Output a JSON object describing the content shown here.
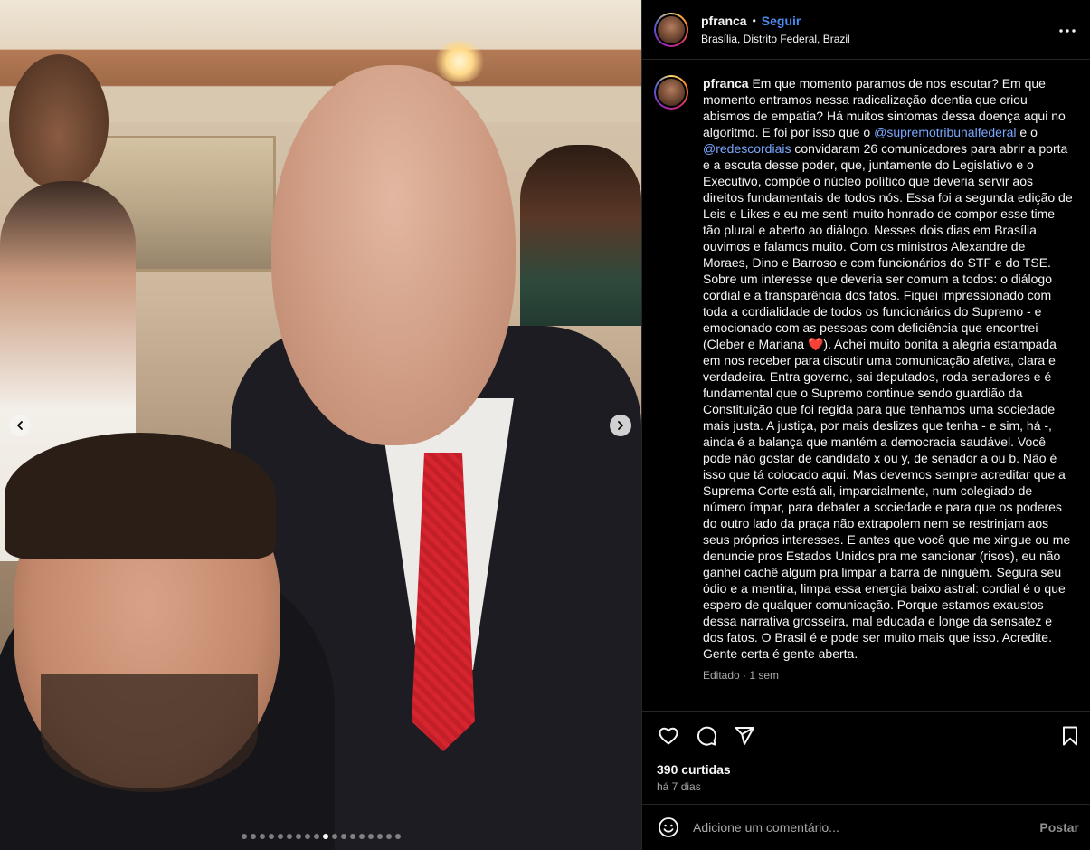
{
  "post": {
    "username": "pfranca",
    "separator": "•",
    "follow_label": "Seguir",
    "location": "Brasília, Distrito Federal, Brazil"
  },
  "carousel": {
    "total_slides": 18,
    "active_slide": 10
  },
  "caption": {
    "username": "pfranca",
    "part1": " Em que momento paramos de nos escutar? Em que momento entramos nessa radicalização doentia que criou abismos de empatia? Há muitos sintomas dessa doença aqui no algoritmo. E foi por isso que o ",
    "mention1": "@supremotribunalfederal",
    "part2": " e o ",
    "mention2": "@redescordiais",
    "part3": " convidaram 26 comunicadores para abrir a porta e a escuta desse poder, que, juntamente do Legislativo e o Executivo, compõe o núcleo político que deveria servir aos direitos fundamentais de todos nós. Essa foi a segunda edição de Leis e Likes e eu me senti muito honrado de compor esse time tão plural e aberto ao diálogo. Nesses dois dias em Brasília ouvimos e falamos muito. Com os ministros Alexandre de Moraes, Dino e Barroso e com funcionários do STF e do TSE. Sobre um interesse que deveria ser comum a todos: o diálogo cordial e a transparência dos fatos. Fiquei impressionado com toda a cordialidade de todos os funcionários do Supremo - e emocionado com as pessoas com deficiência que encontrei (Cleber e Mariana ❤️). Achei muito bonita a alegria estampada em nos receber para discutir uma comunicação afetiva, clara e verdadeira. Entra governo, sai deputados, roda senadores e é fundamental que o Supremo continue sendo guardião da Constituição que foi regida para que tenhamos uma sociedade mais justa. A justiça, por mais deslizes que tenha - e sim, há -, ainda é a balança que mantém a democracia saudável. Você pode não gostar de candidato x ou y, de senador a ou b. Não é isso que tá colocado aqui. Mas devemos sempre acreditar que a Suprema Corte está ali, imparcialmente, num colegiado de número ímpar, para debater a sociedade e para que os poderes do outro lado da praça não extrapolem nem se restrinjam aos seus próprios interesses. E antes que você que me xingue ou me denuncie pros Estados Unidos pra me sancionar (risos), eu não ganhei cachê algum pra limpar a barra de ninguém. Segura seu ódio e a mentira, limpa essa energia baixo astral: cordial é o que espero de qualquer comunicação. Porque estamos exaustos dessa narrativa grosseira, mal educada e longe da sensatez e dos fatos. O Brasil é e pode ser muito mais que isso. Acredite. Gente certa é gente aberta.",
    "edited": "Editado · 1 sem"
  },
  "stats": {
    "likes": "390 curtidas",
    "date": "há 7 dias"
  },
  "comment": {
    "placeholder": "Adicione um comentário...",
    "post_label": "Postar"
  },
  "icons": {
    "like": "heart-icon",
    "comment": "comment-icon",
    "share": "share-icon",
    "save": "bookmark-icon",
    "more": "more-icon",
    "emoji": "emoji-icon",
    "prev": "chevron-left-icon",
    "next": "chevron-right-icon"
  },
  "colors": {
    "link": "#4a8cf0",
    "mention": "#7aa7ff",
    "background": "#000000",
    "text": "#f5f5f5",
    "muted": "#a8a8a8"
  }
}
